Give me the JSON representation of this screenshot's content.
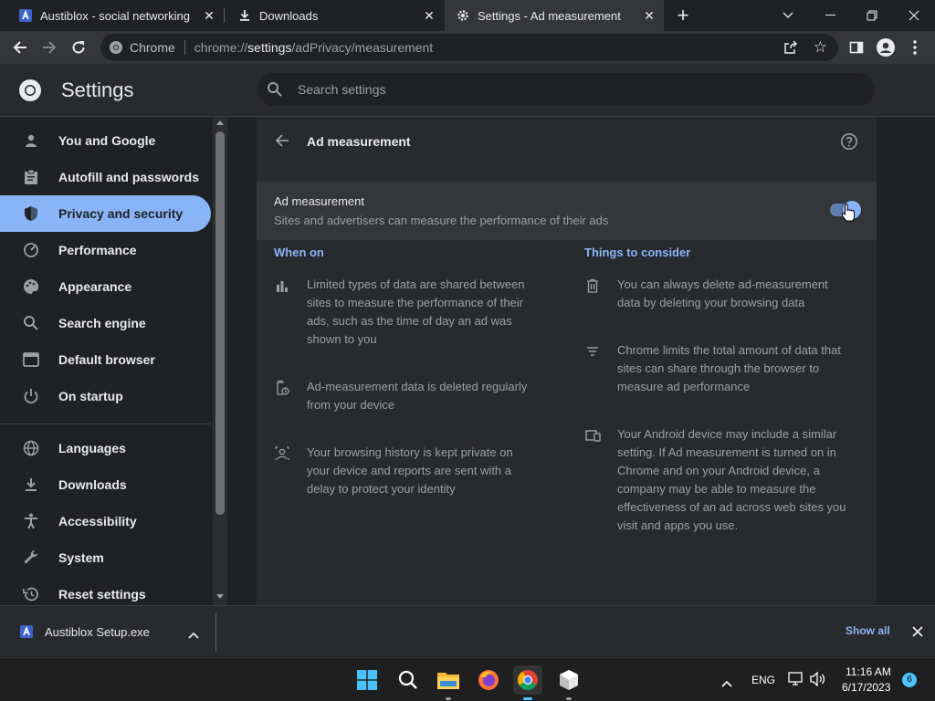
{
  "tabs": [
    {
      "label": "Austiblox - social networking",
      "icon": "austiblox-icon"
    },
    {
      "label": "Downloads",
      "icon": "download-icon"
    },
    {
      "label": "Settings - Ad measurement",
      "icon": "gear-icon"
    }
  ],
  "omnibox": {
    "scheme_label": "Chrome",
    "url_prefix": "chrome://",
    "url_host": "settings",
    "url_path": "/adPrivacy/measurement"
  },
  "settings": {
    "title": "Settings",
    "search_placeholder": "Search settings"
  },
  "sidebar": {
    "items": [
      {
        "label": "You and Google",
        "icon": "person-icon"
      },
      {
        "label": "Autofill and passwords",
        "icon": "clipboard-icon"
      },
      {
        "label": "Privacy and security",
        "icon": "shield-icon",
        "active": true
      },
      {
        "label": "Performance",
        "icon": "speedometer-icon"
      },
      {
        "label": "Appearance",
        "icon": "palette-icon"
      },
      {
        "label": "Search engine",
        "icon": "search-icon"
      },
      {
        "label": "Default browser",
        "icon": "browser-icon"
      },
      {
        "label": "On startup",
        "icon": "power-icon"
      },
      {
        "label": "Languages",
        "icon": "globe-icon"
      },
      {
        "label": "Downloads",
        "icon": "download-icon"
      },
      {
        "label": "Accessibility",
        "icon": "accessibility-icon"
      },
      {
        "label": "System",
        "icon": "wrench-icon"
      },
      {
        "label": "Reset settings",
        "icon": "history-icon"
      }
    ]
  },
  "page": {
    "title": "Ad measurement",
    "toggle": {
      "label": "Ad measurement",
      "description": "Sites and advertisers can measure the performance of their ads",
      "on": true
    },
    "when_on": {
      "heading": "When on",
      "items": [
        {
          "icon": "bar-chart-icon",
          "text": "Limited types of data are shared between sites to measure the performance of their ads, such as the time of day an ad was shown to you"
        },
        {
          "icon": "auto-delete-icon",
          "text": "Ad-measurement data is deleted regularly from your device"
        },
        {
          "icon": "privacy-icon",
          "text": "Your browsing history is kept private on your device and reports are sent with a delay to protect your identity"
        }
      ]
    },
    "consider": {
      "heading": "Things to consider",
      "items": [
        {
          "icon": "trash-icon",
          "text": "You can always delete ad-measurement data by deleting your browsing data"
        },
        {
          "icon": "filter-icon",
          "text": "Chrome limits the total amount of data that sites can share through the browser to measure ad performance"
        },
        {
          "icon": "devices-icon",
          "text": "Your Android device may include a similar setting. If Ad measurement is turned on in Chrome and on your Android device, a company may be able to measure the effectiveness of an ad across web sites you visit and apps you use."
        }
      ]
    }
  },
  "download_shelf": {
    "filename": "Austiblox Setup.exe",
    "show_all": "Show all"
  },
  "taskbar": {
    "language": "ENG",
    "time": "11:16 AM",
    "date": "6/17/2023",
    "notification_count": "6"
  },
  "colors": {
    "accent": "#8ab4f8",
    "toggle_thumb": "#8ab4f8",
    "toggle_track": "#5f7fb0"
  }
}
